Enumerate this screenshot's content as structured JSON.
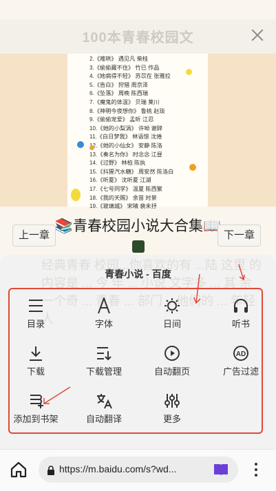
{
  "header": {
    "title": "100本青春校园文"
  },
  "book_list": [
    "2.《难哄》 遇见凡 柴桂",
    "3.《偷偷藏不住》 竹已 作品",
    "4.《她病得不轻》 苏苡在 张雅拉",
    "5.《告白》 狩猎 周京泽",
    "6.《坠落》 周晚 陈西瑞",
    "7.《魔鬼的体温》 贝瑞 莱川",
    "8.《神明今夜想你》 鲁桃 赵琰",
    "9.《偷偷宠爱》 孟听 江忍",
    "10.《她的小梨涡》 许呦 谢辞",
    "11.《白日梦我》 林语惊 沈倦",
    "12.《她的小仙女》 安静 陈洛",
    "13.《奏名为你》 时念念 江昼",
    "14.《过野》 林柏 陈执",
    "15.《抖猩汽水糖》 周安然 陈洛白",
    "16.《听夏》 沈听夏 江湖",
    "17.《七号同学》 温夏 陈西繁",
    "18.《我的天赐》 余苗 时景",
    "19.《玻璃城》 宋晴 裴未抒"
  ],
  "article": {
    "big_title": "📚青春校园小说大合集📖",
    "prev_chapter": "上一章",
    "next_chapter": "下一章",
    "ghost_text": "经典青春 校园...你喜欢的有 ...陆 这里 的内容是 ... 今 年 ... 小说 文字多 ... 其 余一个奇 ... 青春 ... 部门 ...他们的 ... 年轻人"
  },
  "menu_sheet": {
    "title": "青春小说 - 百度",
    "items": [
      {
        "label": "目录",
        "icon": "list-icon"
      },
      {
        "label": "字体",
        "icon": "font-icon"
      },
      {
        "label": "日间",
        "icon": "sun-icon"
      },
      {
        "label": "听书",
        "icon": "headphones-icon"
      },
      {
        "label": "下载",
        "icon": "download-icon"
      },
      {
        "label": "下载管理",
        "icon": "download-manage-icon"
      },
      {
        "label": "自动翻页",
        "icon": "autoplay-icon"
      },
      {
        "label": "广告过滤",
        "icon": "ad-filter-icon"
      },
      {
        "label": "添加到书架",
        "icon": "add-bookshelf-icon"
      },
      {
        "label": "自动翻译",
        "icon": "translate-icon"
      },
      {
        "label": "更多",
        "icon": "sliders-icon"
      }
    ],
    "accent_color": "#e04836"
  },
  "browser": {
    "url": "https://m.baidu.com/s?wd...",
    "reader_color": "#6a3fd6"
  }
}
